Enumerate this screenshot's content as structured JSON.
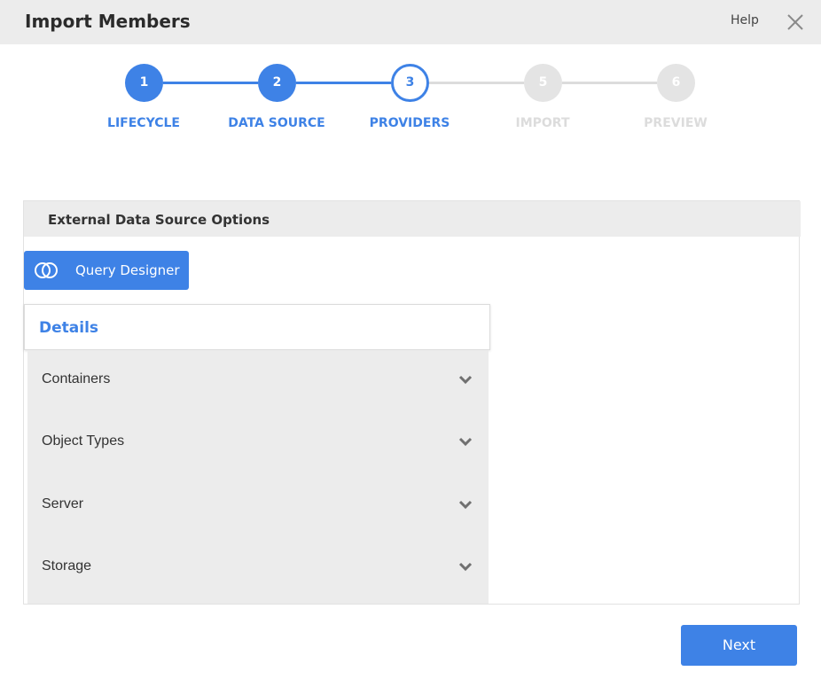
{
  "window": {
    "title": "Import Members",
    "help_label": "Help"
  },
  "stepper": {
    "steps": [
      {
        "number": "1",
        "label": "LIFECYCLE",
        "state": "done"
      },
      {
        "number": "2",
        "label": "DATA SOURCE",
        "state": "done"
      },
      {
        "number": "3",
        "label": "PROVIDERS",
        "state": "current"
      },
      {
        "number": "5",
        "label": "IMPORT",
        "state": "future"
      },
      {
        "number": "6",
        "label": "PREVIEW",
        "state": "future"
      }
    ]
  },
  "panel": {
    "title": "External Data Source Options",
    "query_designer_label": "Query Designer",
    "details_title": "Details",
    "sections": [
      "Containers",
      "Object Types",
      "Server",
      "Storage"
    ]
  },
  "footer": {
    "next_label": "Next"
  },
  "colors": {
    "accent": "#3e82e6",
    "inactive": "#dcdcdc",
    "header_bg": "#ececec"
  }
}
